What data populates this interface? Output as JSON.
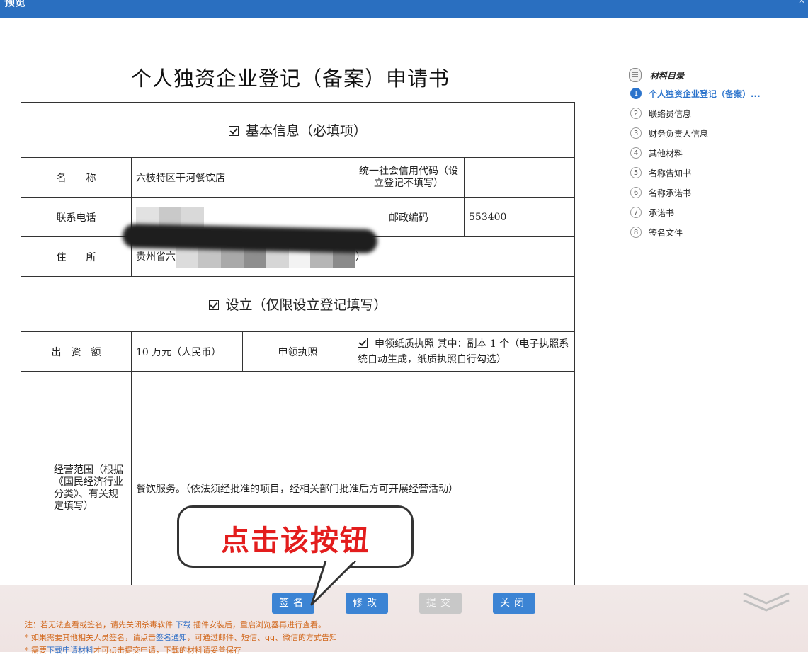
{
  "window": {
    "title": "预览"
  },
  "document": {
    "title": "个人独资企业登记（备案）申请书",
    "section_basic": "基本信息（必填项）",
    "name_label": "名　　称",
    "name_value": "六枝特区干河餐饮店",
    "credit_code_label": "统一社会信用代码（设立登记不填写）",
    "credit_code_value": "",
    "phone_label": "联系电话",
    "postcode_label": "邮政编码",
    "postcode_value": "553400",
    "address_label": "住　　所",
    "address_prefix": "贵州省六",
    "address_suffix": "）",
    "section_establish": "设立（仅限设立登记填写）",
    "capital_label": "出　资　额",
    "capital_value": "10 万元（人民币）",
    "license_label": "申领执照",
    "license_value": "申领纸质执照 其中：副本 1 个（电子执照系统自动生成，纸质执照自行勾选）",
    "scope_label": "经营范围（根据《国民经济行业分类》、有关规定填写）",
    "scope_value": "餐饮服务。（依法须经批准的项目，经相关部门批准后方可开展经营活动）"
  },
  "toc": {
    "heading": "材料目录",
    "items": [
      {
        "num": "1",
        "label": "个人独资企业登记（备案）...",
        "active": true
      },
      {
        "num": "2",
        "label": "联络员信息"
      },
      {
        "num": "3",
        "label": "财务负责人信息"
      },
      {
        "num": "4",
        "label": "其他材料"
      },
      {
        "num": "5",
        "label": "名称告知书"
      },
      {
        "num": "6",
        "label": "名称承诺书"
      },
      {
        "num": "7",
        "label": "承诺书"
      },
      {
        "num": "8",
        "label": "签名文件"
      }
    ]
  },
  "buttons": {
    "sign": "签名",
    "modify": "修改",
    "submit": "提交",
    "close": "关闭"
  },
  "notes": {
    "line1_a": "注：若无法查看或签名，请先关闭杀毒软件  ",
    "line1_link": "下载",
    "line1_b": " 插件安装后，重启浏览器再进行查看。",
    "line2_a": "* 如果需要其他相关人员签名，请点击",
    "line2_link": "签名通知",
    "line2_b": "，可通过邮件、短信、qq、微信的方式告知",
    "line3_a": "* 需要",
    "line3_link": "下载申请材料",
    "line3_b": "才可点击提交申请，下载的材料请妥善保存"
  },
  "callout": {
    "text": "点击该按钮"
  },
  "colors": {
    "titlebar": "#2a6fc0",
    "button": "#3c84d4",
    "callout_text": "#e31d1d",
    "note_text": "#d2691e"
  }
}
